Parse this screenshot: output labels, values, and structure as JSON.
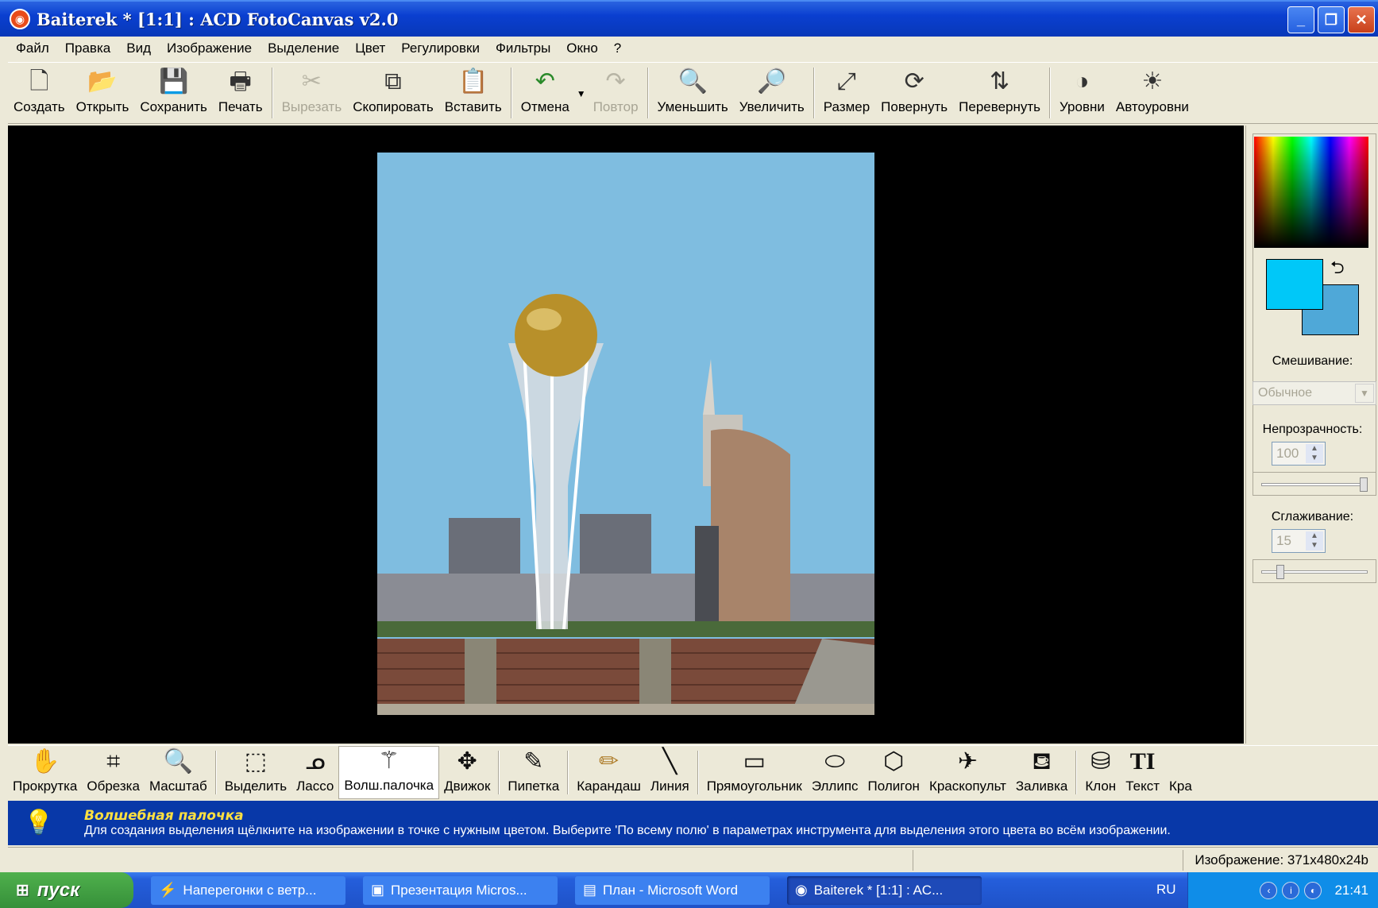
{
  "window": {
    "title": "Baiterek * [1:1] : ACD FotoCanvas v2.0",
    "controls": [
      "minimize-icon",
      "restore-icon",
      "close-icon"
    ]
  },
  "menu": [
    "Файл",
    "Правка",
    "Вид",
    "Изображение",
    "Выделение",
    "Цвет",
    "Регулировки",
    "Фильтры",
    "Окно",
    "?"
  ],
  "toolbar": {
    "create": "Создать",
    "open": "Открыть",
    "save": "Сохранить",
    "print": "Печать",
    "cut": "Вырезать",
    "copy": "Скопировать",
    "paste": "Вставить",
    "undo": "Отмена",
    "redo": "Повтор",
    "zoom_out": "Уменьшить",
    "zoom_in": "Увеличить",
    "resize": "Размер",
    "rotate": "Повернуть",
    "flip": "Перевернуть",
    "levels": "Уровни",
    "auto_levels": "Автоуровни"
  },
  "panel": {
    "foreground_color": "#00c8f8",
    "background_color": "#4fa8d8",
    "blend_label": "Смешивание:",
    "blend_value": "Обычное",
    "opacity_label": "Непрозрачность:",
    "opacity_value": "100",
    "opacity_level": 1.0,
    "smoothing_label": "Сглаживание:",
    "smoothing_value": "15",
    "smoothing_level": 0.15
  },
  "tools": {
    "pan": "Прокрутка",
    "crop": "Обрезка",
    "zoom": "Масштаб",
    "select": "Выделить",
    "lasso": "Лассо",
    "magic_wand": "Волш.палочка",
    "move": "Движок",
    "eyedropper": "Пипетка",
    "pencil": "Карандаш",
    "line": "Линия",
    "rectangle": "Прямоугольник",
    "ellipse": "Эллипс",
    "polygon": "Полигон",
    "airbrush": "Краскопульт",
    "fill": "Заливка",
    "clone": "Клон",
    "text": "Текст",
    "cut_off": "Кра"
  },
  "hint": {
    "title": "Волшебная палочка",
    "text": "Для создания выделения щёлкните на изображении в точке с нужным цветом. Выберите 'По всему полю' в параметрах инструмента для выделения этого цвета во всём изображении."
  },
  "status": {
    "image_info": "Изображение: 371x480x24b"
  },
  "taskbar": {
    "start": "пуск",
    "tasks": [
      "Наперегонки с ветр...",
      "Презентация Micros...",
      "План - Microsoft Word",
      "Baiterek * [1:1] : AC..."
    ],
    "lang": "RU",
    "time": "21:41"
  }
}
